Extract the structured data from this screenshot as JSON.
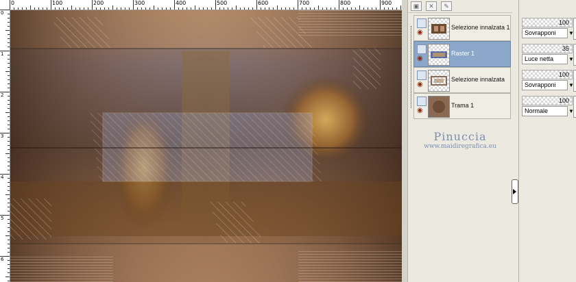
{
  "ruler": {
    "top_labels": [
      "0",
      "100",
      "200",
      "300",
      "400",
      "500",
      "600",
      "700",
      "800",
      "900"
    ],
    "left_labels": [
      "0",
      "1",
      "2",
      "3",
      "4",
      "5",
      "6"
    ]
  },
  "layers": [
    {
      "name": "Selezione innalzata 1",
      "selected": false
    },
    {
      "name": "Raster 1",
      "selected": true
    },
    {
      "name": "Selezione innalzata",
      "selected": false
    },
    {
      "name": "Trama 1",
      "selected": false
    }
  ],
  "properties": [
    {
      "opacity": "100",
      "blend": "Sovrapponi"
    },
    {
      "opacity": "35",
      "blend": "Luce netta"
    },
    {
      "opacity": "100",
      "blend": "Sovrapponi"
    },
    {
      "opacity": "100",
      "blend": "Normale"
    }
  ],
  "watermark": {
    "name": "Pinuccia",
    "url": "www.maidiregrafica.eu"
  },
  "colors": {
    "selected_layer": "#8ba7c9",
    "canvas_base": "#7a5a40",
    "watermark": "#7a8fb0"
  }
}
